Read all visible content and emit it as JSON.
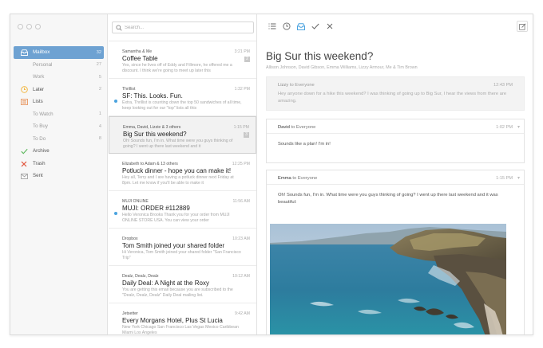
{
  "sidebar": {
    "items": [
      {
        "label": "Mailbox",
        "count": "32",
        "icon": "mailbox-icon",
        "active": true,
        "sub": false
      },
      {
        "label": "Personal",
        "count": "27",
        "sub": true
      },
      {
        "label": "Work",
        "count": "5",
        "sub": true
      },
      {
        "label": "Later",
        "count": "2",
        "icon": "clock-icon",
        "sub": false
      },
      {
        "label": "Lists",
        "count": "",
        "icon": "lists-icon",
        "sub": false
      },
      {
        "label": "To Watch",
        "count": "1",
        "sub": true
      },
      {
        "label": "To Buy",
        "count": "4",
        "sub": true
      },
      {
        "label": "To Do",
        "count": "8",
        "sub": true
      },
      {
        "label": "Archive",
        "count": "",
        "icon": "checkmark-icon",
        "sub": false
      },
      {
        "label": "Trash",
        "count": "",
        "icon": "trash-x-icon",
        "sub": false
      },
      {
        "label": "Sent",
        "count": "",
        "icon": "sent-envelope-icon",
        "sub": false
      }
    ]
  },
  "search": {
    "placeholder": "Search..."
  },
  "messages": [
    {
      "from": "Samantha & Me",
      "time": "3:21 PM",
      "subject": "Coffee Table",
      "preview": "Yes, since he lives off of Eddy and Fillmore, he offered me a discount. I think we're going to meet up later this",
      "thread": "2",
      "unread": false
    },
    {
      "from": "Thrillist",
      "time": "1:32 PM",
      "subject": "SF: This. Looks. Fun.",
      "preview": "Extra, Thrillist is counting down the top 50 sandwiches of all time, keep looking out for our \"top\" lists all this",
      "thread": "",
      "unread": true
    },
    {
      "from": "Emma, David, Lizzie & 3 others",
      "time": "1:15 PM",
      "subject": "Big Sur this weekend?",
      "preview": "Oh! Sounds fun, I'm in. What time were you guys thinking of going? I went up there last weekend and it",
      "thread": "3",
      "unread": false,
      "selected": true
    },
    {
      "from": "Elizabeth to Adam & 13 others",
      "time": "12:25 PM",
      "subject": "Potluck dinner - hope you can make it!",
      "preview": "Hey all, Terry and I are having a potluck dinner next Friday at 8pm. Let me know if you'll be able to make it",
      "thread": "",
      "unread": false
    },
    {
      "from": "MUJI ONLINE",
      "time": "11:56 AM",
      "subject": "MUJI: ORDER #112889",
      "preview": "Hello Veronica Brooks Thank you for your order from MUJI ONLINE STORE USA. You can view your order",
      "thread": "",
      "unread": true
    },
    {
      "from": "Dropbox",
      "time": "10:23 AM",
      "subject": "Tom Smith joined your shared folder",
      "preview": "Hi Veronica, Tom Smith joined your shared folder \"San Francisco Trip\"",
      "thread": "",
      "unread": false
    },
    {
      "from": "Dealz, Dealz, Dealz",
      "time": "10:12 AM",
      "subject": "Daily Deal: A Night at the Roxy",
      "preview": "You are getting this email because you are subscribed to the \"Dealz, Dealz, Dealz\" Daily Deal mailing list.",
      "thread": "",
      "unread": false
    },
    {
      "from": "Jetsetter",
      "time": "9:42 AM",
      "subject": "Every Morgans Hotel, Plus St Lucia",
      "preview": "New York Chicago San Francisco Las Vegas Mexico Caribbean Miami Los Angeles",
      "thread": "",
      "unread": false
    }
  ],
  "reading": {
    "title": "Big Sur this weekend?",
    "participants": "Allison Johnson, David Gibson, Emma Williams, Lizzy Armour, Me & Tim Brown",
    "cards": [
      {
        "sender": "Lizzy",
        "to": "to Everyone",
        "time": "12:43 PM",
        "body": "Hey anyone down for a hike this weekend? I was thinking of going up to Big Sur, I hear the views from there are amazing."
      },
      {
        "sender": "David",
        "to": "to Everyone",
        "time": "1:02 PM",
        "body": "Sounds like a plan! I'm in!"
      },
      {
        "sender": "Emma",
        "to": "to Everyone",
        "time": "1:15 PM",
        "body": "Oh! Sounds fun, I'm in. What time were you guys thinking of going? I went up there last weekend and it was beautiful:"
      }
    ]
  },
  "colors": {
    "accent": "#6ea2d2",
    "unread_dot": "#4aa3df"
  }
}
